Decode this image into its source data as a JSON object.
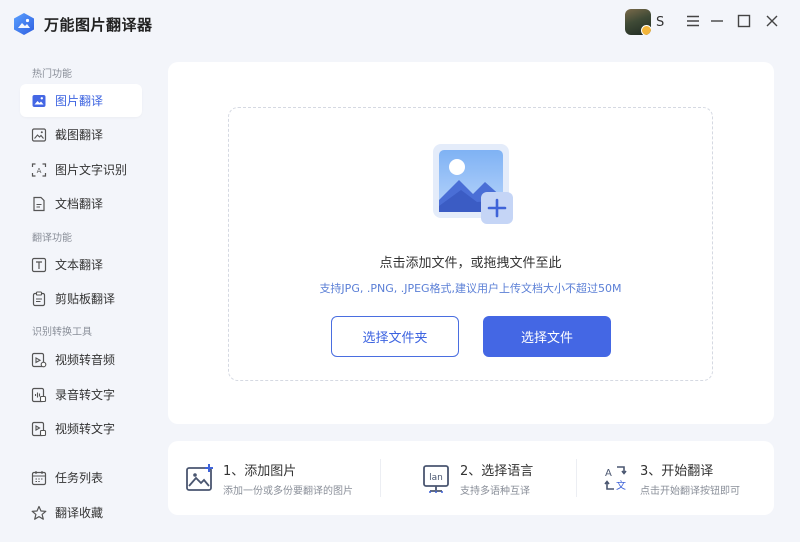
{
  "app": {
    "title": "万能图片翻译器",
    "user_name": "S"
  },
  "colors": {
    "accent": "#4467e4",
    "background": "#f3f5fa",
    "hint": "#5b7fd6"
  },
  "sidebar": {
    "groups": [
      {
        "label": "热门功能",
        "items": [
          {
            "label": "图片翻译",
            "icon": "image-icon",
            "active": true
          },
          {
            "label": "截图翻译",
            "icon": "screenshot-icon"
          },
          {
            "label": "图片文字识别",
            "icon": "ocr-icon"
          },
          {
            "label": "文档翻译",
            "icon": "document-icon"
          }
        ]
      },
      {
        "label": "翻译功能",
        "items": [
          {
            "label": "文本翻译",
            "icon": "text-icon"
          },
          {
            "label": "剪贴板翻译",
            "icon": "clipboard-icon"
          }
        ]
      },
      {
        "label": "识别转换工具",
        "items": [
          {
            "label": "视频转音频",
            "icon": "video-audio-icon"
          },
          {
            "label": "录音转文字",
            "icon": "recording-text-icon"
          },
          {
            "label": "视频转文字",
            "icon": "video-text-icon"
          }
        ]
      }
    ],
    "bottom": [
      {
        "label": "任务列表",
        "icon": "calendar-icon"
      },
      {
        "label": "翻译收藏",
        "icon": "star-icon"
      }
    ]
  },
  "upload": {
    "title": "点击添加文件，或拖拽文件至此",
    "hint": "支持JPG, .PNG, .JPEG格式,建议用户上传文档大小不超过50M",
    "folder_button": "选择文件夹",
    "file_button": "选择文件"
  },
  "steps": [
    {
      "title": "1、添加图片",
      "desc": "添加一份或多份要翻译的图片",
      "icon": "add-image-icon"
    },
    {
      "title": "2、选择语言",
      "desc": "支持多语种互译",
      "icon": "language-icon"
    },
    {
      "title": "3、开始翻译",
      "desc": "点击开始翻译按钮即可",
      "icon": "translate-icon"
    }
  ]
}
